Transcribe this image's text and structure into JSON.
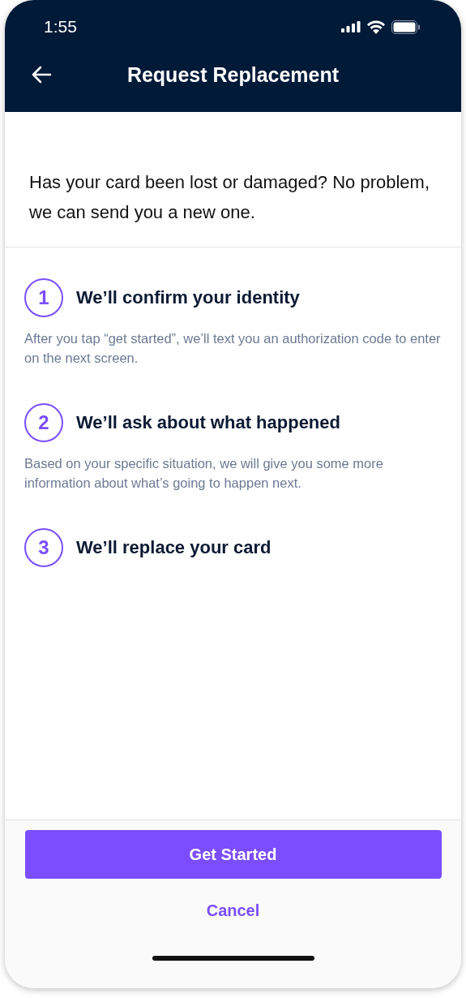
{
  "status_bar": {
    "time": "1:55"
  },
  "header": {
    "title": "Request Replacement"
  },
  "intro": "Has your card been lost or damaged? No problem, we can send you a new one.",
  "steps": [
    {
      "number": "1",
      "title": "We’ll confirm your identity",
      "description": "After you tap “get started”, we’ll text you an authorization code to enter on the next screen."
    },
    {
      "number": "2",
      "title": "We’ll ask about what happened",
      "description": "Based on your specific situation, we will give you some more information about what’s going to happen next."
    },
    {
      "number": "3",
      "title": "We’ll replace your card"
    }
  ],
  "buttons": {
    "primary": "Get Started",
    "secondary": "Cancel"
  }
}
